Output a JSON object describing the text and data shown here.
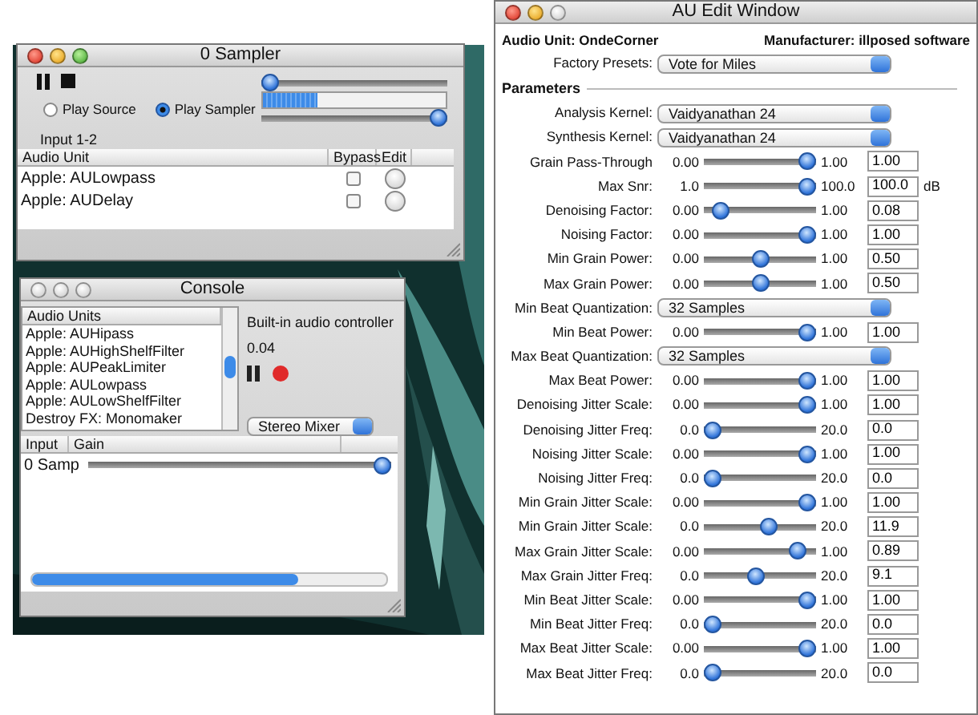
{
  "sampler_window": {
    "title": "0 Sampler",
    "active": true,
    "zoom_enabled": true,
    "position_slider": {
      "level": 0
    },
    "meter": {
      "level": 0.3
    },
    "volume_slider": {
      "level": 1
    },
    "play_options": [
      {
        "label": "Play Source",
        "selected": false
      },
      {
        "label": "Play Sampler",
        "selected": true
      }
    ],
    "input_label": "Input 1-2",
    "table": {
      "columns": [
        "Audio Unit",
        "Bypass",
        "Edit"
      ],
      "rows": [
        {
          "audio_unit": "Apple: AULowpass",
          "bypass": false
        },
        {
          "audio_unit": "Apple: AUDelay",
          "bypass": false
        }
      ]
    }
  },
  "console_window": {
    "title": "Console",
    "active": false,
    "audio_units": {
      "header": "Audio Units",
      "items": [
        "Apple: AUHipass",
        "Apple: AUHighShelfFilter",
        "Apple: AUPeakLimiter",
        "Apple: AULowpass",
        "Apple: AULowShelfFilter",
        "Destroy FX: Monomaker"
      ]
    },
    "device": "Built-in audio controller",
    "reading": "0.04",
    "mixer_popup": "Stereo Mixer",
    "inputs_table": {
      "columns": [
        "Input",
        "Gain"
      ],
      "rows": [
        {
          "input": "0 Samp",
          "level": 1
        }
      ]
    }
  },
  "au_window": {
    "title": "AU Edit Window",
    "active": true,
    "zoom_enabled": false,
    "audio_unit": "Audio Unit: OndeCorner",
    "manufacturer": "Manufacturer: illposed software",
    "factory_presets": {
      "label": "Factory Presets:",
      "value": "Vote for Miles"
    },
    "section": "Parameters",
    "parameters": [
      {
        "kind": "popup",
        "label": "Analysis Kernel:",
        "value": "Vaidyanathan 24"
      },
      {
        "kind": "popup",
        "label": "Synthesis Kernel:",
        "value": "Vaidyanathan 24"
      },
      {
        "kind": "slider",
        "label": "Grain Pass-Through",
        "min": "0.00",
        "max": "1.00",
        "level": 1,
        "value": "1.00"
      },
      {
        "kind": "slider",
        "label": "Max Snr:",
        "min": "1.0",
        "max": "100.0",
        "level": 1,
        "value": "100.0",
        "unit": "dB"
      },
      {
        "kind": "slider",
        "label": "Denoising Factor:",
        "min": "0.00",
        "max": "1.00",
        "level": 0.08,
        "value": "0.08"
      },
      {
        "kind": "slider",
        "label": "Noising Factor:",
        "min": "0.00",
        "max": "1.00",
        "level": 1,
        "value": "1.00"
      },
      {
        "kind": "slider",
        "label": "Min Grain Power:",
        "min": "0.00",
        "max": "1.00",
        "level": 0.5,
        "value": "0.50"
      },
      {
        "kind": "slider",
        "label": "Max Grain Power:",
        "min": "0.00",
        "max": "1.00",
        "level": 0.5,
        "value": "0.50"
      },
      {
        "kind": "popup",
        "label": "Min Beat Quantization:",
        "value": "32 Samples"
      },
      {
        "kind": "slider",
        "label": "Min Beat Power:",
        "min": "0.00",
        "max": "1.00",
        "level": 1,
        "value": "1.00"
      },
      {
        "kind": "popup",
        "label": "Max Beat Quantization:",
        "value": "32 Samples"
      },
      {
        "kind": "slider",
        "label": "Max Beat Power:",
        "min": "0.00",
        "max": "1.00",
        "level": 1,
        "value": "1.00"
      },
      {
        "kind": "slider",
        "label": "Denoising Jitter Scale:",
        "min": "0.00",
        "max": "1.00",
        "level": 1,
        "value": "1.00"
      },
      {
        "kind": "slider",
        "label": "Denoising Jitter Freq:",
        "min": "0.0",
        "max": "20.0",
        "level": 0,
        "value": "0.0"
      },
      {
        "kind": "slider",
        "label": "Noising Jitter Scale:",
        "min": "0.00",
        "max": "1.00",
        "level": 1,
        "value": "1.00"
      },
      {
        "kind": "slider",
        "label": "Noising Jitter Freq:",
        "min": "0.0",
        "max": "20.0",
        "level": 0,
        "value": "0.0"
      },
      {
        "kind": "slider",
        "label": "Min Grain Jitter Scale:",
        "min": "0.00",
        "max": "1.00",
        "level": 1,
        "value": "1.00"
      },
      {
        "kind": "slider",
        "label": "Min Grain Jitter Scale:",
        "min": "0.0",
        "max": "20.0",
        "level": 0.595,
        "value": "11.9"
      },
      {
        "kind": "slider",
        "label": "Max Grain Jitter Scale:",
        "min": "0.00",
        "max": "1.00",
        "level": 0.89,
        "value": "0.89"
      },
      {
        "kind": "slider",
        "label": "Max Grain Jitter Freq:",
        "min": "0.0",
        "max": "20.0",
        "level": 0.455,
        "value": "9.1"
      },
      {
        "kind": "slider",
        "label": "Min Beat Jitter Scale:",
        "min": "0.00",
        "max": "1.00",
        "level": 1,
        "value": "1.00"
      },
      {
        "kind": "slider",
        "label": "Min Beat Jitter Freq:",
        "min": "0.0",
        "max": "20.0",
        "level": 0,
        "value": "0.0"
      },
      {
        "kind": "slider",
        "label": "Max Beat Jitter Scale:",
        "min": "0.00",
        "max": "1.00",
        "level": 1,
        "value": "1.00"
      },
      {
        "kind": "slider",
        "label": "Max Beat Jitter Freq:",
        "min": "0.0",
        "max": "20.0",
        "level": 0,
        "value": "0.0"
      }
    ]
  }
}
